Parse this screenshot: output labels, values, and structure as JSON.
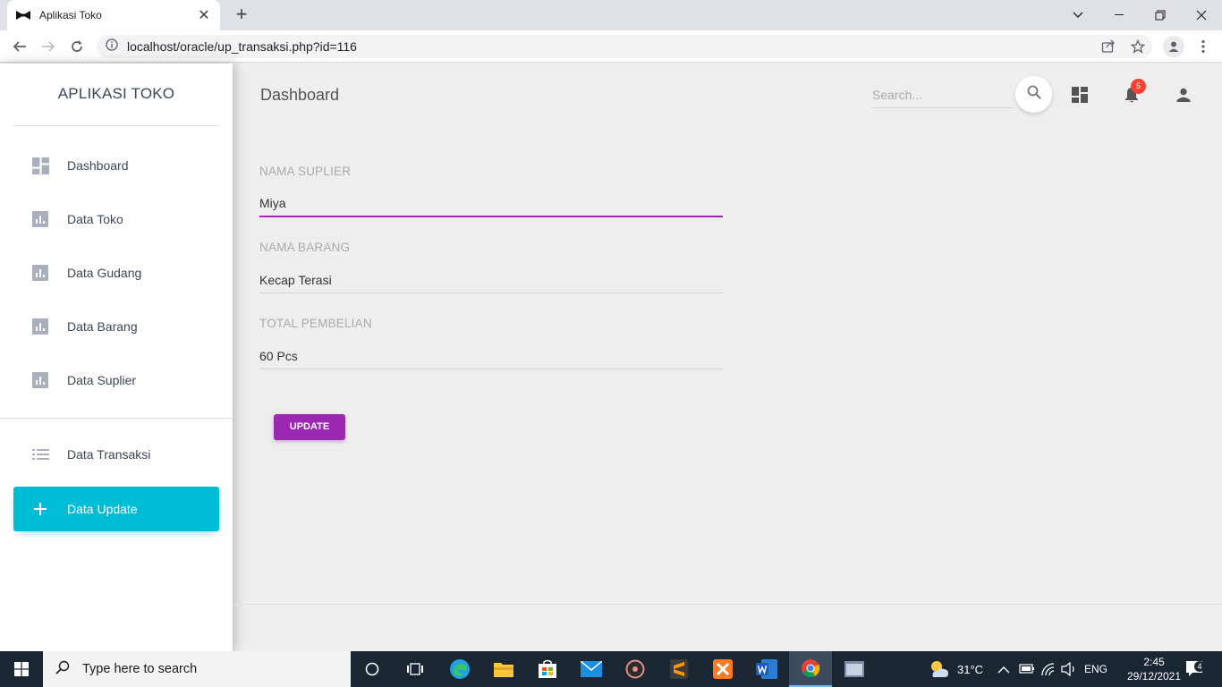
{
  "browser": {
    "tab_title": "Aplikasi Toko",
    "url": "localhost/oracle/up_transaksi.php?id=116"
  },
  "sidebar": {
    "brand": "APLIKASI TOKO",
    "items": [
      {
        "label": "Dashboard",
        "icon": "dashboard-icon"
      },
      {
        "label": "Data Toko",
        "icon": "bar-chart-icon"
      },
      {
        "label": "Data Gudang",
        "icon": "bar-chart-icon"
      },
      {
        "label": "Data Barang",
        "icon": "bar-chart-icon"
      },
      {
        "label": "Data Suplier",
        "icon": "bar-chart-icon"
      },
      {
        "label": "Data Transaksi",
        "icon": "list-icon"
      },
      {
        "label": "Data Update",
        "icon": "plus-icon",
        "active": true
      }
    ]
  },
  "header": {
    "title": "Dashboard",
    "search_placeholder": "Search...",
    "notification_count": "5"
  },
  "form": {
    "fields": [
      {
        "label": "NAMA SUPLIER",
        "value": "Miya"
      },
      {
        "label": "NAMA BARANG",
        "value": "Kecap Terasi"
      },
      {
        "label": "TOTAL PEMBELIAN",
        "value": "60 Pcs"
      }
    ],
    "submit_label": "UPDATE"
  },
  "taskbar": {
    "search_placeholder": "Type here to search",
    "weather": "31°C",
    "language": "ENG",
    "time": "2:45",
    "date": "29/12/2021",
    "notification_count": "4"
  },
  "colors": {
    "accent_primary": "#9c27b0",
    "accent_active_nav": "#00bcd4",
    "badge": "#f44336"
  }
}
